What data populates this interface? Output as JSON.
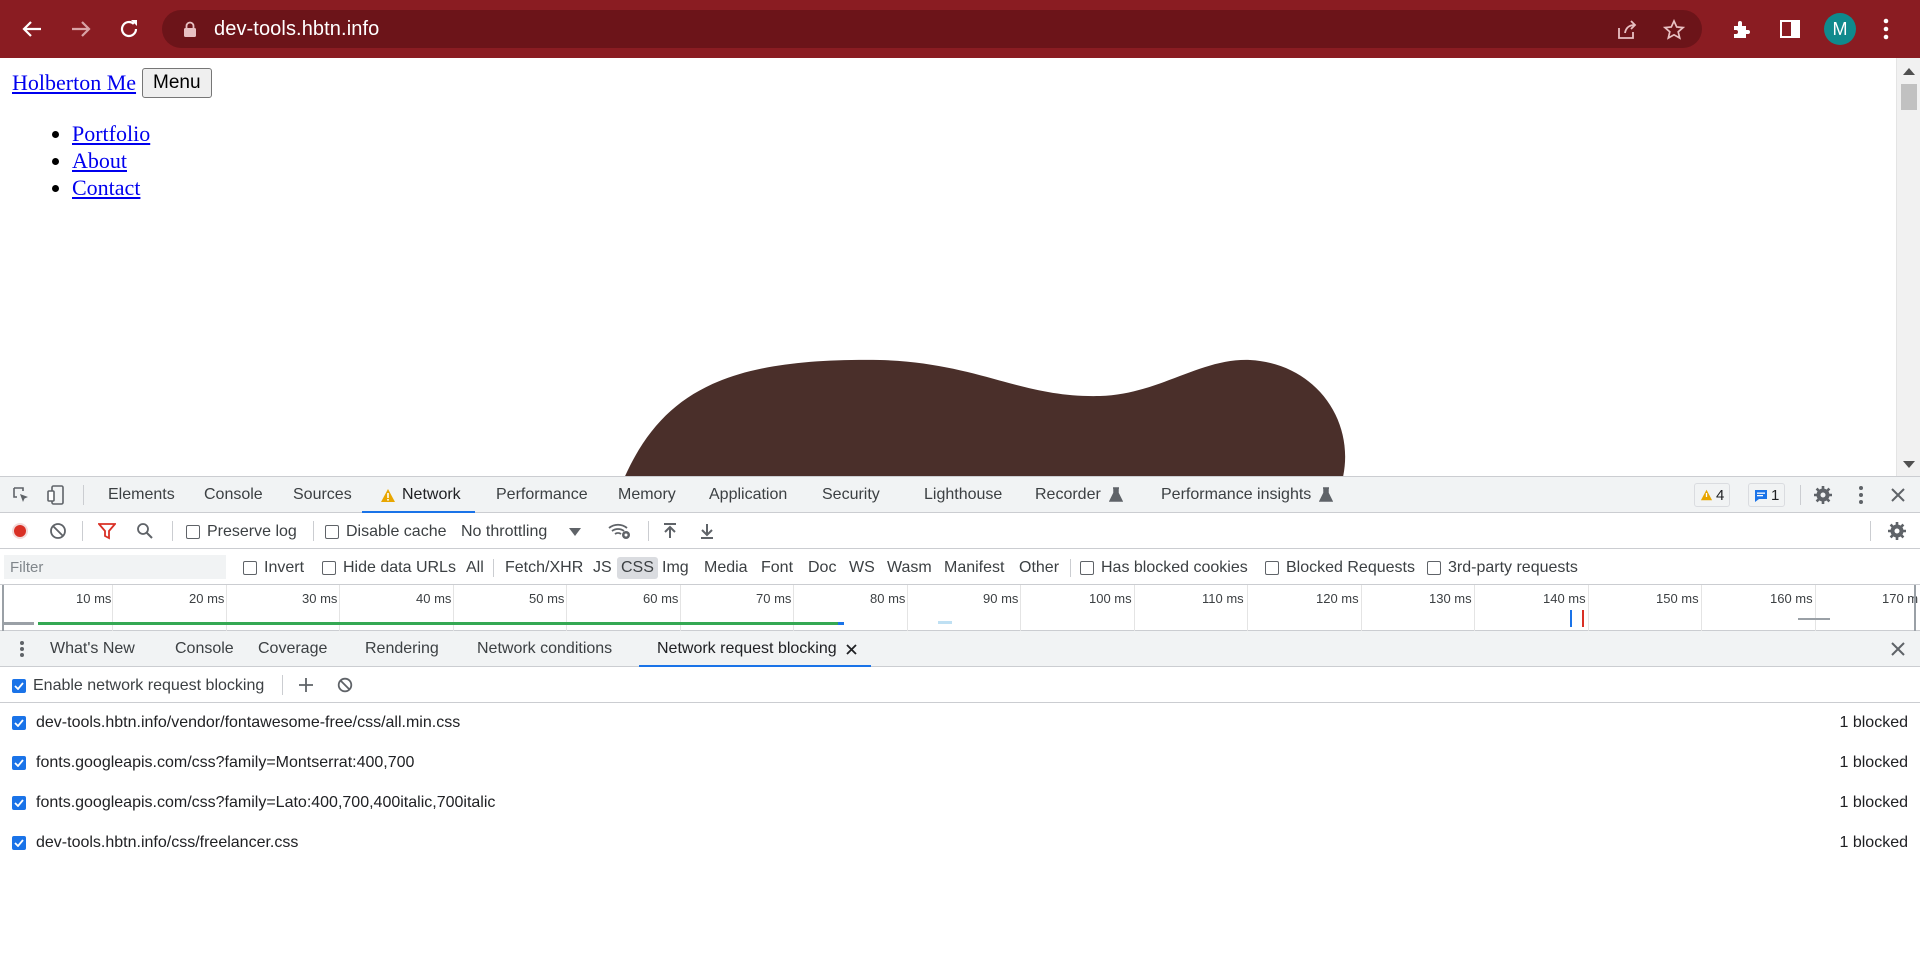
{
  "browser": {
    "url": "dev-tools.hbtn.info",
    "avatar_letter": "M",
    "theme_color": "#8a1c22",
    "icons": [
      "back-icon",
      "forward-icon",
      "reload-icon",
      "lock-icon",
      "share-icon",
      "star-icon",
      "extensions-icon",
      "sidepanel-icon",
      "kebab-menu-icon"
    ]
  },
  "page": {
    "brand": "Holberton Me",
    "menu_button": "Menu",
    "links": [
      "Portfolio",
      "About",
      "Contact"
    ],
    "blob_color": "#4a2f2a"
  },
  "devtools": {
    "tabs": {
      "elements": "Elements",
      "console": "Console",
      "sources": "Sources",
      "network": "Network",
      "performance": "Performance",
      "memory": "Memory",
      "application": "Application",
      "security": "Security",
      "lighthouse": "Lighthouse",
      "recorder": "Recorder",
      "performance_insights": "Performance insights"
    },
    "warnings_count": "4",
    "messages_count": "1",
    "toolbar": {
      "preserve_log": "Preserve log",
      "disable_cache": "Disable cache",
      "throttling": "No throttling"
    },
    "filter": {
      "placeholder": "Filter",
      "invert": "Invert",
      "hide_data_urls": "Hide data URLs",
      "types": {
        "all": "All",
        "fetch_xhr": "Fetch/XHR",
        "js": "JS",
        "css": "CSS",
        "img": "Img",
        "media": "Media",
        "font": "Font",
        "doc": "Doc",
        "ws": "WS",
        "wasm": "Wasm",
        "manifest": "Manifest",
        "other": "Other"
      },
      "active_type": "CSS",
      "has_blocked_cookies": "Has blocked cookies",
      "blocked_requests": "Blocked Requests",
      "third_party": "3rd-party requests"
    },
    "timeline_ticks": [
      "10 ms",
      "20 ms",
      "30 ms",
      "40 ms",
      "50 ms",
      "60 ms",
      "70 ms",
      "80 ms",
      "90 ms",
      "100 ms",
      "110 ms",
      "120 ms",
      "130 ms",
      "140 ms",
      "150 ms",
      "160 ms",
      "170 m"
    ],
    "drawer": {
      "tabs": {
        "whats_new": "What's New",
        "console": "Console",
        "coverage": "Coverage",
        "rendering": "Rendering",
        "network_conditions": "Network conditions",
        "request_blocking": "Network request blocking"
      },
      "enable_label": "Enable network request blocking",
      "rules": [
        {
          "pattern": "dev-tools.hbtn.info/vendor/fontawesome-free/css/all.min.css",
          "count": "1 blocked",
          "enabled": true
        },
        {
          "pattern": "fonts.googleapis.com/css?family=Montserrat:400,700",
          "count": "1 blocked",
          "enabled": true
        },
        {
          "pattern": "fonts.googleapis.com/css?family=Lato:400,700,400italic,700italic",
          "count": "1 blocked",
          "enabled": true
        },
        {
          "pattern": "dev-tools.hbtn.info/css/freelancer.css",
          "count": "1 blocked",
          "enabled": true
        }
      ]
    }
  }
}
